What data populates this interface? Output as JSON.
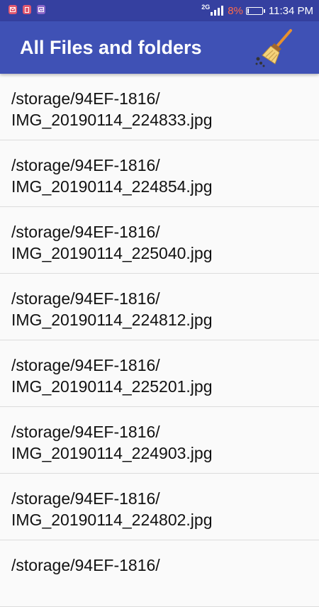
{
  "status_bar": {
    "network_type": "2G",
    "battery_percent_text": "8%",
    "battery_level": 0.08,
    "time": "11:34 PM",
    "notification_icons": [
      "mail-notification-icon",
      "document-notification-icon",
      "image-notification-icon"
    ]
  },
  "app_bar": {
    "title": "All Files and folders",
    "action_icon": "broom-icon"
  },
  "files": [
    {
      "dir": "/storage/94EF-1816/",
      "name": "IMG_20190114_224833.jpg"
    },
    {
      "dir": "/storage/94EF-1816/",
      "name": "IMG_20190114_224854.jpg"
    },
    {
      "dir": "/storage/94EF-1816/",
      "name": "IMG_20190114_225040.jpg"
    },
    {
      "dir": "/storage/94EF-1816/",
      "name": "IMG_20190114_224812.jpg"
    },
    {
      "dir": "/storage/94EF-1816/",
      "name": "IMG_20190114_225201.jpg"
    },
    {
      "dir": "/storage/94EF-1816/",
      "name": "IMG_20190114_224903.jpg"
    },
    {
      "dir": "/storage/94EF-1816/",
      "name": "IMG_20190114_224802.jpg"
    },
    {
      "dir": "/storage/94EF-1816/",
      "name": ""
    }
  ],
  "colors": {
    "status_bar": "#3540a0",
    "app_bar": "#3f51b5",
    "battery_low": "#ff6a4a",
    "background": "#fafafa"
  }
}
